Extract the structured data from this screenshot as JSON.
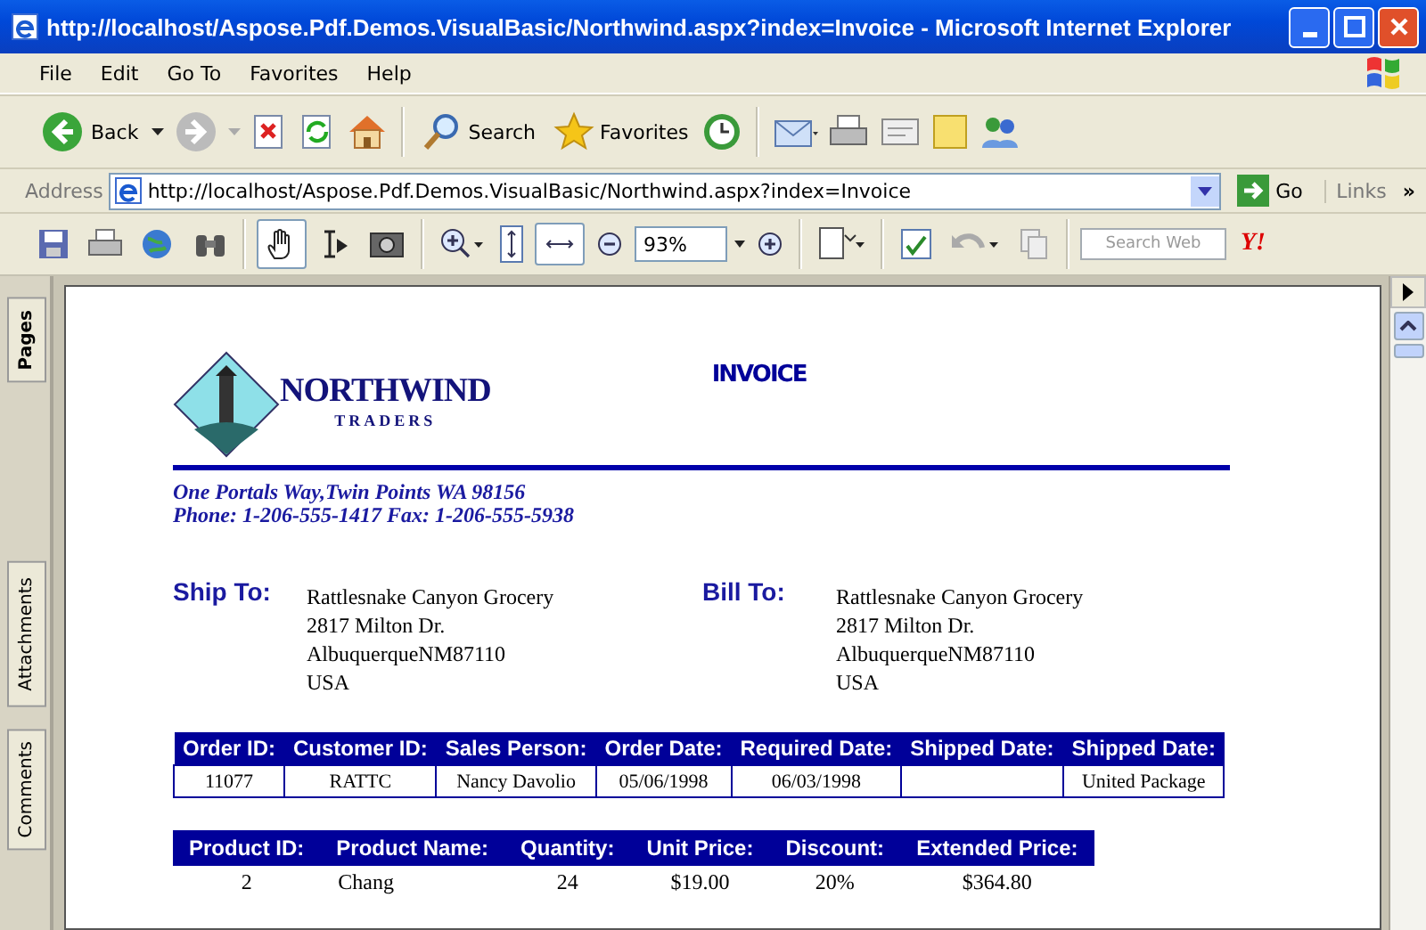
{
  "window": {
    "title": "http://localhost/Aspose.Pdf.Demos.VisualBasic/Northwind.aspx?index=Invoice - Microsoft Internet Explorer"
  },
  "menu": [
    "File",
    "Edit",
    "Go To",
    "Favorites",
    "Help"
  ],
  "toolbar": {
    "back": "Back",
    "search": "Search",
    "favorites": "Favorites"
  },
  "address_bar": {
    "label": "Address",
    "url": "http://localhost/Aspose.Pdf.Demos.VisualBasic/Northwind.aspx?index=Invoice",
    "go": "Go",
    "links": "Links",
    "more": "»"
  },
  "pdf_toolbar": {
    "zoom": "93%",
    "search": {
      "placeholder": "Search Web"
    },
    "logo": "Y!"
  },
  "side_tabs": [
    "Pages",
    "Attachments",
    "Comments"
  ],
  "document": {
    "company": "NORTHWIND",
    "company_sub": "TRADERS",
    "title": "INVOICE",
    "address_lines": [
      "One Portals Way,Twin Points WA 98156",
      "Phone: 1-206-555-1417 Fax: 1-206-555-5938"
    ],
    "ship_to": {
      "label": "Ship To:",
      "lines": [
        "Rattlesnake Canyon Grocery",
        "2817 Milton Dr.",
        "AlbuquerqueNM87110",
        "USA"
      ]
    },
    "bill_to": {
      "label": "Bill To:",
      "lines": [
        "Rattlesnake Canyon Grocery",
        "2817 Milton Dr.",
        "AlbuquerqueNM87110",
        "USA"
      ]
    },
    "order_table": {
      "columns": [
        "Order ID:",
        "Customer ID:",
        "Sales Person:",
        "Order Date:",
        "Required Date:",
        "Shipped Date:",
        "Shipped Date:"
      ],
      "rows": [
        [
          "11077",
          "RATTC",
          "Nancy Davolio",
          "05/06/1998",
          "06/03/1998",
          "",
          "United Package"
        ]
      ]
    },
    "product_table": {
      "columns": [
        "Product ID:",
        "Product Name:",
        "Quantity:",
        "Unit Price:",
        "Discount:",
        "Extended Price:"
      ],
      "rows": [
        [
          "2",
          "Chang",
          "24",
          "$19.00",
          "20%",
          "$364.80"
        ]
      ]
    }
  }
}
